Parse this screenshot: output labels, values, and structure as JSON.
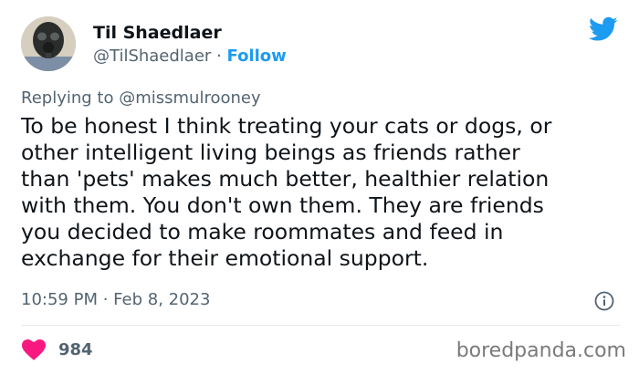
{
  "author": {
    "display_name": "Til Shaedlaer",
    "handle": "@TilShaedlaer",
    "separator": "·",
    "follow_label": "Follow",
    "avatar_icon": "gas-mask-avatar"
  },
  "platform_icon": "twitter-bird-icon",
  "reply_context": {
    "prefix": "Replying to",
    "mention": "@missmulrooney"
  },
  "tweet": {
    "lines": [
      "To be honest I think treating your cats or dogs, or",
      "other intelligent living beings as friends rather",
      "than 'pets' makes much better, healthier relation",
      "with them. You don't own them. They are friends",
      "you decided to make roommates and feed in",
      "exchange for their emotional support."
    ],
    "timestamp": "10:59 PM · Feb 8, 2023"
  },
  "engagement": {
    "likes": "984",
    "like_icon": "heart-icon",
    "like_color": "#f91880"
  },
  "watermark": "boredpanda.com",
  "colors": {
    "accent": "#1d9bf0",
    "text": "#0f1419",
    "secondary": "#536471"
  }
}
